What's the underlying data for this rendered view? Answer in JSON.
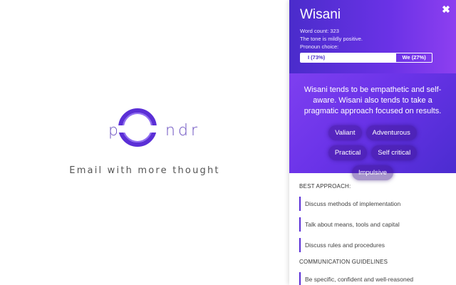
{
  "logo": {
    "letters": [
      "p",
      "n",
      "d",
      "r"
    ],
    "tagline": "Email with more thought"
  },
  "panel": {
    "name": "Wisani",
    "close_label": "✖",
    "word_count": "Word count: 323",
    "tone": "The tone is mildly positive.",
    "pronoun_label": "Pronoun choice:",
    "pronoun_i": "I (73%)",
    "pronoun_we": "We (27%)",
    "pronoun_i_fraction": 0.73,
    "summary": "Wisani tends to be empathetic and self-aware. Wisani also tends to take a pragmatic approach focused on results.",
    "traits": [
      "Valiant",
      "Adventurous",
      "Practical",
      "Self critical",
      "Impulsive"
    ],
    "best_approach_title": "BEST APPROACH:",
    "best_approach": [
      "Discuss methods of implementation",
      "Talk about means, tools and capital",
      "Discuss rules and procedures"
    ],
    "communication_title": "COMMUNICATION GUIDELINES",
    "communication": [
      "Be specific, confident and well-reasoned"
    ]
  },
  "colors": {
    "brand_purple": "#5b2fd6",
    "header_gradient_start": "#4a2ccb",
    "header_gradient_end": "#8d3ff0"
  }
}
